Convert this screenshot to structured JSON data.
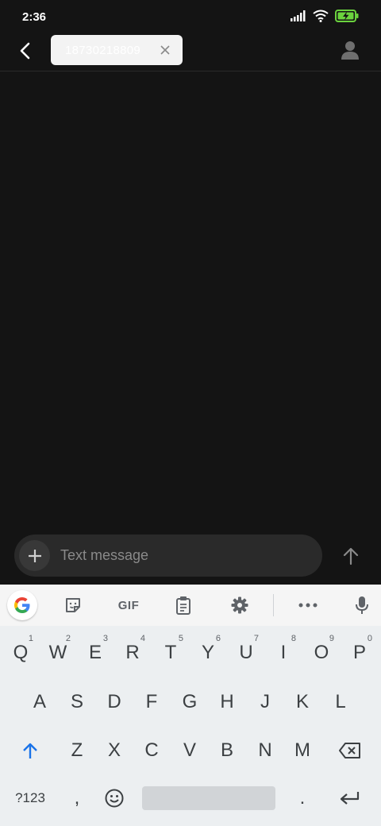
{
  "status_bar": {
    "time": "2:36",
    "icons": [
      "signal-icon",
      "wifi-icon",
      "battery-charging-icon"
    ]
  },
  "header": {
    "recipient_chip": "18730218809"
  },
  "compose": {
    "placeholder": "Text message"
  },
  "keyboard": {
    "toolbar": {
      "gif_label": "GIF"
    },
    "rows": [
      [
        {
          "label": "Q",
          "hint": "1"
        },
        {
          "label": "W",
          "hint": "2"
        },
        {
          "label": "E",
          "hint": "3"
        },
        {
          "label": "R",
          "hint": "4"
        },
        {
          "label": "T",
          "hint": "5"
        },
        {
          "label": "Y",
          "hint": "6"
        },
        {
          "label": "U",
          "hint": "7"
        },
        {
          "label": "I",
          "hint": "8"
        },
        {
          "label": "O",
          "hint": "9"
        },
        {
          "label": "P",
          "hint": "0"
        }
      ],
      [
        {
          "label": "A"
        },
        {
          "label": "S"
        },
        {
          "label": "D"
        },
        {
          "label": "F"
        },
        {
          "label": "G"
        },
        {
          "label": "H"
        },
        {
          "label": "J"
        },
        {
          "label": "K"
        },
        {
          "label": "L"
        }
      ],
      [
        {
          "label": "Z"
        },
        {
          "label": "X"
        },
        {
          "label": "C"
        },
        {
          "label": "V"
        },
        {
          "label": "B"
        },
        {
          "label": "N"
        },
        {
          "label": "M"
        }
      ]
    ],
    "symbols_label": "?123",
    "comma_label": ",",
    "period_label": "."
  },
  "colors": {
    "background": "#141414",
    "accent": "#1a73e8",
    "keyboard_bg": "#eceff1"
  }
}
